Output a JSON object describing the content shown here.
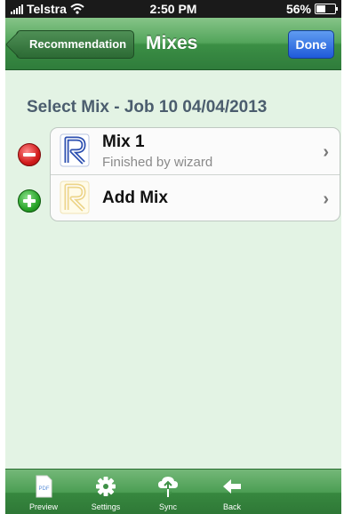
{
  "status_bar": {
    "carrier": "Telstra",
    "time": "2:50 PM",
    "battery": "56%",
    "battery_level": 0.56
  },
  "nav": {
    "back_label": "Recommendation",
    "title": "Mixes",
    "done_label": "Done"
  },
  "section": {
    "title": "Select Mix - Job 10 04/04/2013"
  },
  "list": {
    "items": [
      {
        "title": "Mix 1",
        "subtitle": "Finished by wizard",
        "icon": "r-logo-icon"
      },
      {
        "title": "Add Mix",
        "icon": "r-logo-faded-icon"
      }
    ]
  },
  "toolbar": {
    "items": [
      {
        "label": "Preview",
        "icon": "pdf-icon"
      },
      {
        "label": "Settings",
        "icon": "gear-icon"
      },
      {
        "label": "Sync",
        "icon": "cloud-sync-icon"
      },
      {
        "label": "Back",
        "icon": "back-arrow-icon"
      }
    ]
  },
  "colors": {
    "nav_green": "#53a55b",
    "background": "#e3f3e4",
    "done_blue": "#1f5ad9",
    "remove_red": "#d21c1c",
    "add_green": "#2aa52a"
  }
}
